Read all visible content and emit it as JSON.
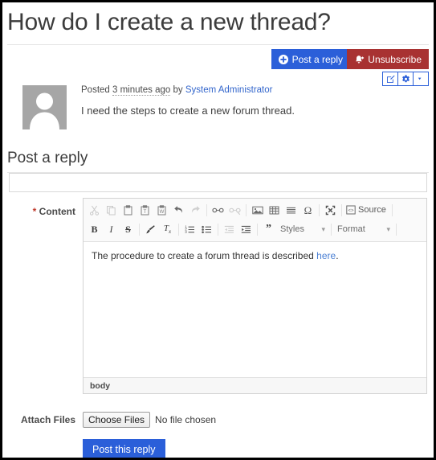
{
  "thread": {
    "title": "How do I create a new thread?",
    "post": {
      "posted_prefix": "Posted",
      "relative_time": "3 minutes ago",
      "by_label": "by",
      "author": "System Administrator",
      "body": "I need the steps to create a new forum thread.",
      "avatar_name": "user-avatar-placeholder"
    }
  },
  "actions": {
    "post_a_reply": "Post a reply",
    "unsubscribe": "Unsubscribe",
    "edit_icon": "edit-icon",
    "settings_icon": "gear-icon",
    "more_icon": "chevron-down-icon"
  },
  "reply_form": {
    "section_title": "Post a reply",
    "subject": {
      "value": "",
      "placeholder": ""
    },
    "content_label_star": "*",
    "content_label": "Content",
    "editor": {
      "toolbar_row1": [
        {
          "name": "cut-icon",
          "glyph": "cut",
          "dim": true
        },
        {
          "name": "copy-icon",
          "glyph": "copy",
          "dim": true
        },
        {
          "name": "paste-icon",
          "glyph": "paste",
          "dim": false
        },
        {
          "name": "paste-text-icon",
          "glyph": "paste-text",
          "dim": false
        },
        {
          "name": "paste-word-icon",
          "glyph": "paste-word",
          "dim": false
        },
        {
          "name": "undo-icon",
          "glyph": "undo",
          "dim": false
        },
        {
          "name": "redo-icon",
          "glyph": "redo",
          "dim": true
        },
        {
          "name": "separator",
          "glyph": "sep",
          "dim": false
        },
        {
          "name": "link-icon",
          "glyph": "link",
          "dim": false
        },
        {
          "name": "unlink-icon",
          "glyph": "unlink",
          "dim": true
        },
        {
          "name": "separator",
          "glyph": "sep",
          "dim": false
        },
        {
          "name": "image-icon",
          "glyph": "image",
          "dim": false
        },
        {
          "name": "table-icon",
          "glyph": "table",
          "dim": false
        },
        {
          "name": "horizontal-rule-icon",
          "glyph": "hrule",
          "dim": false
        },
        {
          "name": "special-character-icon",
          "glyph": "omega",
          "dim": false
        },
        {
          "name": "separator",
          "glyph": "sep",
          "dim": false
        },
        {
          "name": "maximize-icon",
          "glyph": "maximize",
          "dim": false
        },
        {
          "name": "separator",
          "glyph": "sep",
          "dim": false
        }
      ],
      "source_label": "Source",
      "toolbar_row2": [
        {
          "name": "bold-icon",
          "glyph": "B",
          "dim": false
        },
        {
          "name": "italic-icon",
          "glyph": "I",
          "dim": false
        },
        {
          "name": "strikethrough-icon",
          "glyph": "S",
          "dim": false
        },
        {
          "name": "separator",
          "glyph": "sep",
          "dim": false
        },
        {
          "name": "copy-formatting-icon",
          "glyph": "brush",
          "dim": false
        },
        {
          "name": "remove-format-icon",
          "glyph": "Tx",
          "dim": false
        },
        {
          "name": "separator",
          "glyph": "sep",
          "dim": false
        },
        {
          "name": "numbered-list-icon",
          "glyph": "ol",
          "dim": false
        },
        {
          "name": "bulleted-list-icon",
          "glyph": "ul",
          "dim": false
        },
        {
          "name": "separator",
          "glyph": "sep",
          "dim": false
        },
        {
          "name": "decrease-indent-icon",
          "glyph": "outdent",
          "dim": true
        },
        {
          "name": "increase-indent-icon",
          "glyph": "indent",
          "dim": false
        },
        {
          "name": "separator",
          "glyph": "sep",
          "dim": false
        },
        {
          "name": "blockquote-icon",
          "glyph": "quote",
          "dim": false
        }
      ],
      "styles_label": "Styles",
      "format_label": "Format",
      "combo_caret": "▾",
      "content_text_before": "The procedure to create a forum thread is described ",
      "content_link_text": "here",
      "content_text_after": ".",
      "status_path": "body"
    },
    "attach": {
      "label": "Attach Files",
      "choose_button": "Choose Files",
      "no_file_text": "No file chosen"
    },
    "submit_label": "Post this reply"
  },
  "colors": {
    "primary": "#2b5fd9",
    "danger": "#a83232",
    "link": "#3366cc",
    "required": "#c0392b",
    "avatar": "#a6a6a6"
  }
}
